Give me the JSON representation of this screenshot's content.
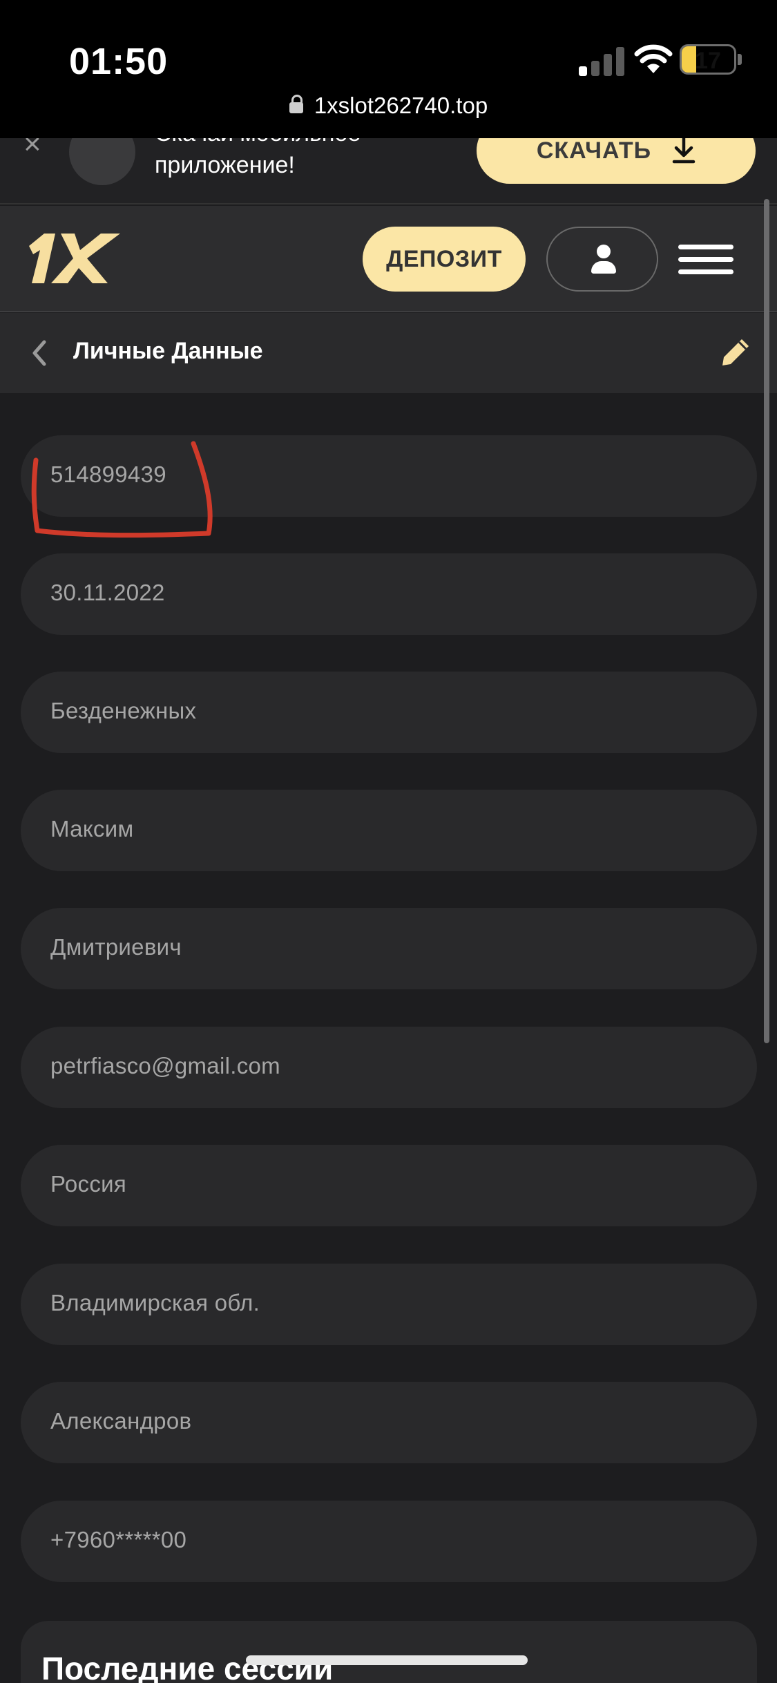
{
  "status_bar": {
    "time": "01:50",
    "battery_level": "17",
    "url": "1xslot262740.top"
  },
  "banner": {
    "close_symbol": "×",
    "text": "Скачай мобильное приложение!",
    "download_label": "СКАЧАТЬ",
    "download_icon": "download-icon"
  },
  "header": {
    "logo_text": "1X",
    "deposit_label": "ДЕПОЗИТ",
    "profile_icon": "user-icon",
    "menu_icon": "hamburger-menu-icon"
  },
  "page": {
    "title": "Личные Данные",
    "back_icon": "chevron-left-icon",
    "edit_icon": "pencil-icon"
  },
  "fields": [
    {
      "value": "514899439"
    },
    {
      "value": "30.11.2022"
    },
    {
      "value": "Безденежных"
    },
    {
      "value": "Максим"
    },
    {
      "value": "Дмитриевич"
    },
    {
      "value": "petrfiasco@gmail.com"
    },
    {
      "value": "Россия"
    },
    {
      "value": "Владимирская обл."
    },
    {
      "value": "Александров"
    },
    {
      "value": "+7960*****00"
    }
  ],
  "sessions": {
    "title": "Последние сессии"
  },
  "colors": {
    "accent": "#fbe6a6",
    "background": "#1d1d1f",
    "field_bg": "#29292b",
    "annotation": "#d03a2a"
  }
}
